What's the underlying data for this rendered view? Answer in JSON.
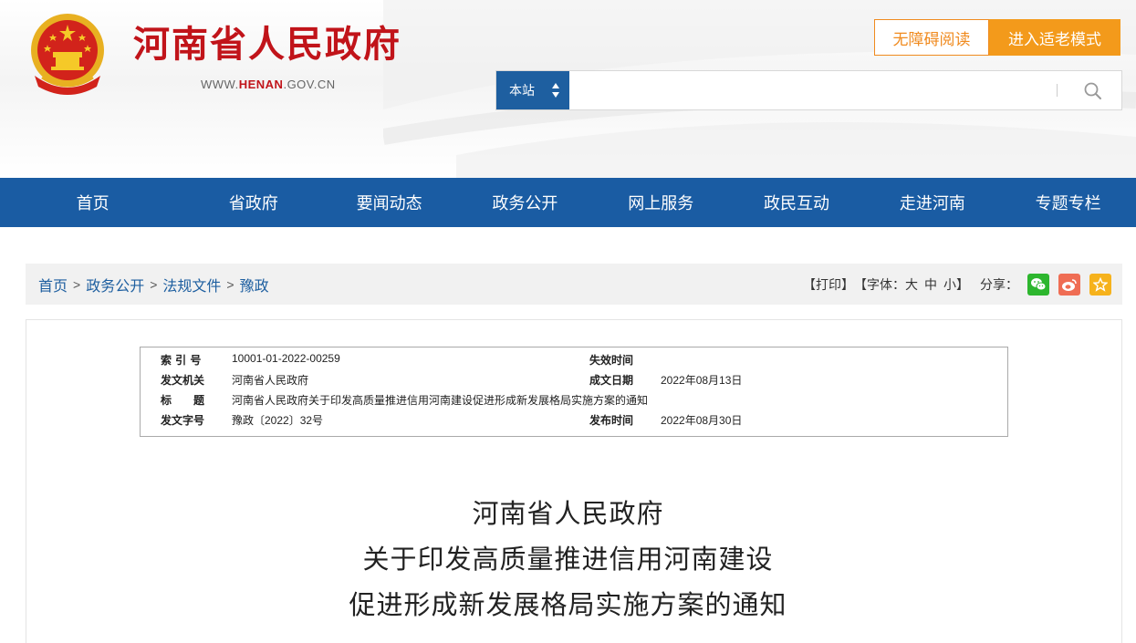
{
  "header": {
    "site_title": "河南省人民政府",
    "site_url_prefix": "WWW.",
    "site_url_domain": "HENAN",
    "site_url_suffix": ".GOV.CN",
    "btn_accessible": "无障碍阅读",
    "btn_elder": "进入适老模式",
    "search_scope": "本站",
    "search_placeholder": ""
  },
  "nav": {
    "items": [
      "首页",
      "省政府",
      "要闻动态",
      "政务公开",
      "网上服务",
      "政民互动",
      "走进河南",
      "专题专栏"
    ]
  },
  "breadcrumb": {
    "items": [
      "首页",
      "政务公开",
      "法规文件",
      "豫政"
    ],
    "separator": ">"
  },
  "tools": {
    "print": "【打印】",
    "font_prefix": "【字体：",
    "font_large": "大",
    "font_medium": "中",
    "font_small": "小",
    "font_suffix": "】",
    "share_label": "分享："
  },
  "meta": {
    "index_label": "索 引 号",
    "index_value": "10001-01-2022-00259",
    "expire_label": "失效时间",
    "expire_value": "",
    "issuer_label": "发文机关",
    "issuer_value": "河南省人民政府",
    "made_label": "成文日期",
    "made_value": "2022年08月13日",
    "title_label": "标　　题",
    "title_value": "河南省人民政府关于印发高质量推进信用河南建设促进形成新发展格局实施方案的通知",
    "docno_label": "发文字号",
    "docno_value": "豫政〔2022〕32号",
    "publish_label": "发布时间",
    "publish_value": "2022年08月30日"
  },
  "document": {
    "title_line1": "河南省人民政府",
    "title_line2": "关于印发高质量推进信用河南建设",
    "title_line3": "促进形成新发展格局实施方案的通知"
  },
  "colors": {
    "brand_red": "#c1141a",
    "nav_blue": "#1a5ca3",
    "accent_orange": "#f39a1b"
  }
}
